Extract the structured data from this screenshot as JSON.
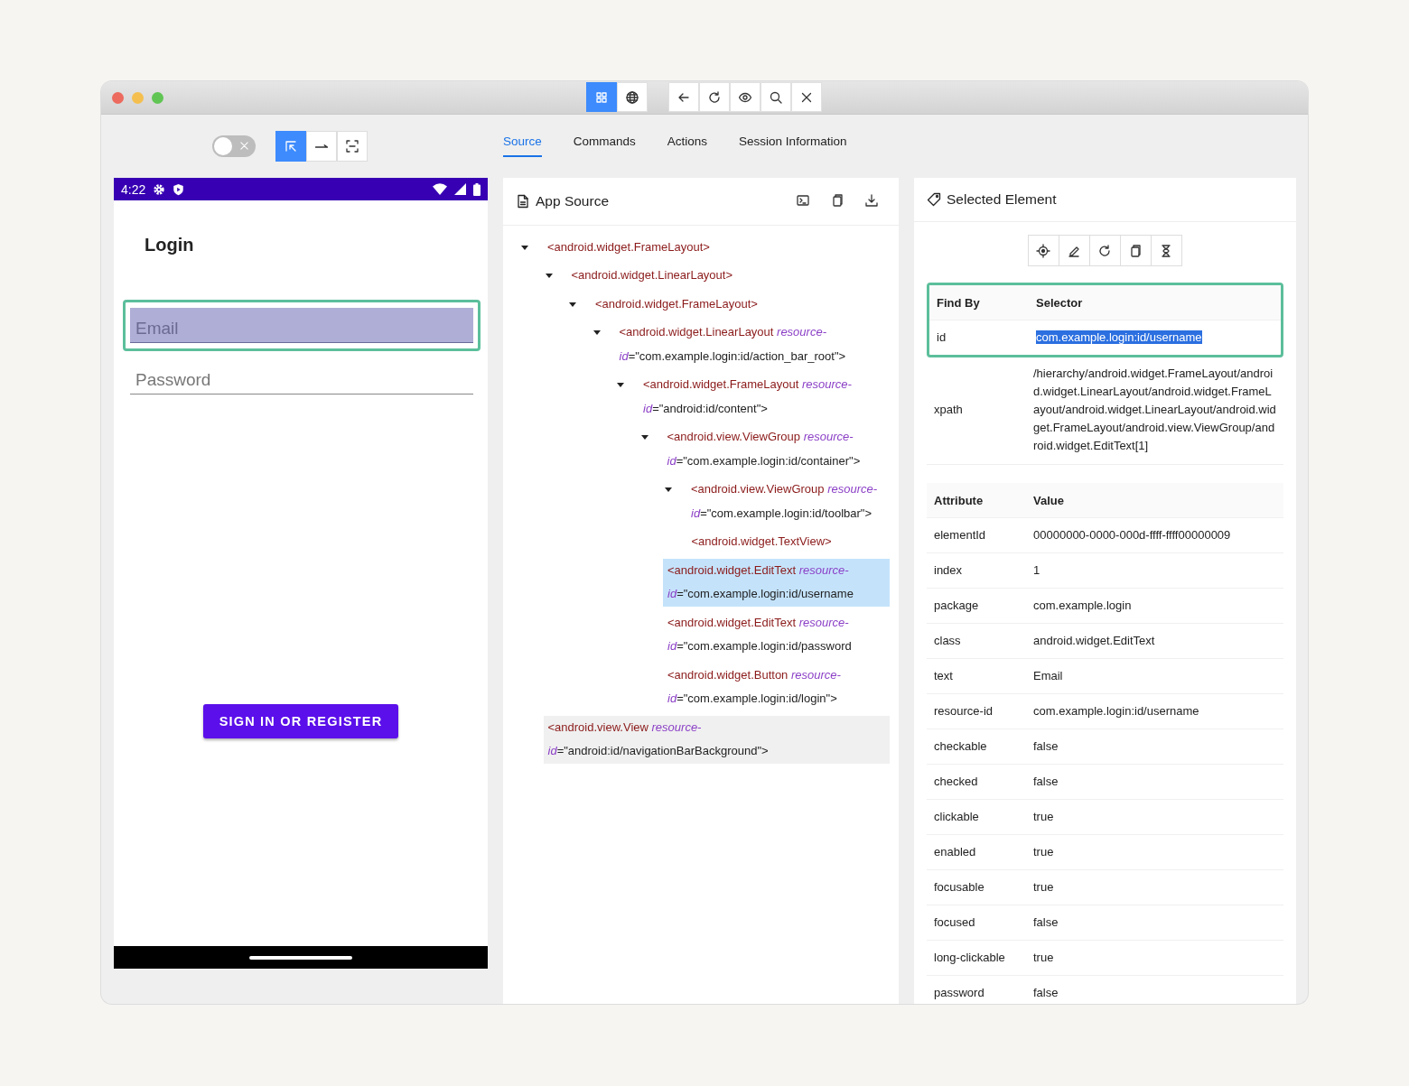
{
  "window": {
    "traffic_lights": [
      {
        "color": "#ec6a5e"
      },
      {
        "color": "#f4bf4f"
      },
      {
        "color": "#61c554"
      }
    ],
    "mode_buttons": [
      {
        "kind": "grid",
        "selected": true
      },
      {
        "kind": "globe",
        "selected": false
      }
    ],
    "nav_buttons": [
      {
        "kind": "back"
      },
      {
        "kind": "refresh"
      },
      {
        "kind": "eye"
      },
      {
        "kind": "search"
      },
      {
        "kind": "close"
      }
    ]
  },
  "device_toolbar": {
    "toggle": {
      "on": false
    },
    "tools": [
      {
        "kind": "select",
        "selected": true
      },
      {
        "kind": "swipe",
        "selected": false
      },
      {
        "kind": "tap",
        "selected": false
      }
    ]
  },
  "tabs": [
    {
      "label": "Source",
      "selected": true
    },
    {
      "label": "Commands",
      "selected": false
    },
    {
      "label": "Actions",
      "selected": false
    },
    {
      "label": "Session Information",
      "selected": false
    }
  ],
  "device": {
    "time": "4:22",
    "title": "Login",
    "fields": [
      {
        "placeholder": "Email",
        "selected": true
      },
      {
        "placeholder": "Password",
        "selected": false
      }
    ],
    "button": "SIGN IN OR REGISTER"
  },
  "app_source": {
    "title": "App Source",
    "tree": [
      {
        "tag": "<android.widget.FrameLayout>",
        "expanded": true,
        "selected": false,
        "hovered": false,
        "children": [
          {
            "tag": "<android.widget.LinearLayout>",
            "expanded": true,
            "selected": false,
            "hovered": false,
            "children": [
              {
                "tag": "<android.widget.FrameLayout>",
                "expanded": true,
                "selected": false,
                "hovered": false,
                "children": [
                  {
                    "tag": "<android.widget.LinearLayout ",
                    "attr": "resource-id",
                    "value": "=\"com.example.login:id/action_bar_root\">",
                    "expanded": true,
                    "selected": false,
                    "hovered": false,
                    "children": [
                      {
                        "tag": "<android.widget.FrameLayout ",
                        "attr": "resource-id",
                        "value": "=\"android:id/content\">",
                        "expanded": true,
                        "selected": false,
                        "hovered": false,
                        "children": [
                          {
                            "tag": "<android.view.ViewGroup ",
                            "attr": "resource-id",
                            "value": "=\"com.example.login:id/container\">",
                            "expanded": true,
                            "selected": false,
                            "hovered": false,
                            "children": [
                              {
                                "tag": "<android.view.ViewGroup ",
                                "attr": "resource-id",
                                "value": "=\"com.example.login:id/toolbar\">",
                                "expanded": true,
                                "selected": false,
                                "hovered": false,
                                "children": [
                                  {
                                    "tag": "<android.widget.TextView>",
                                    "selected": false,
                                    "hovered": false
                                  }
                                ]
                              },
                              {
                                "tag": "<android.widget.EditText ",
                                "attr": "resource-id",
                                "value": "=\"com.example.login:id/username",
                                "selected": true,
                                "hovered": false
                              },
                              {
                                "tag": "<android.widget.EditText ",
                                "attr": "resource-id",
                                "value": "=\"com.example.login:id/password",
                                "selected": false,
                                "hovered": false
                              },
                              {
                                "tag": "<android.widget.Button ",
                                "attr": "resource-id",
                                "value": "=\"com.example.login:id/login\">",
                                "selected": false,
                                "hovered": false
                              }
                            ]
                          }
                        ]
                      }
                    ]
                  }
                ]
              }
            ]
          },
          {
            "tag": "<android.view.View ",
            "attr": "resource-id",
            "value": "=\"android:id/navigationBarBackground\">",
            "selected": false,
            "hovered": true
          }
        ]
      }
    ]
  },
  "selected_element": {
    "title": "Selected Element",
    "tools": [
      {
        "kind": "locate"
      },
      {
        "kind": "edit"
      },
      {
        "kind": "refresh"
      },
      {
        "kind": "copy"
      },
      {
        "kind": "timer"
      }
    ],
    "selector_columns": [
      "Find By",
      "Selector"
    ],
    "selectors": [
      {
        "find_by": "id",
        "selector": "com.example.login:id/username",
        "highlighted": true
      },
      {
        "find_by": "xpath",
        "selector": "/hierarchy/android.widget.FrameLayout/android.widget.LinearLayout/android.widget.FrameLayout/android.widget.LinearLayout/android.widget.FrameLayout/android.view.ViewGroup/android.widget.EditText[1]",
        "highlighted": false
      }
    ],
    "attribute_columns": [
      "Attribute",
      "Value"
    ],
    "attributes": [
      [
        "elementId",
        "00000000-0000-000d-ffff-ffff00000009"
      ],
      [
        "index",
        "1"
      ],
      [
        "package",
        "com.example.login"
      ],
      [
        "class",
        "android.widget.EditText"
      ],
      [
        "text",
        "Email"
      ],
      [
        "resource-id",
        "com.example.login:id/username"
      ],
      [
        "checkable",
        "false"
      ],
      [
        "checked",
        "false"
      ],
      [
        "clickable",
        "true"
      ],
      [
        "enabled",
        "true"
      ],
      [
        "focusable",
        "true"
      ],
      [
        "focused",
        "false"
      ],
      [
        "long-clickable",
        "true"
      ],
      [
        "password",
        "false"
      ]
    ]
  }
}
